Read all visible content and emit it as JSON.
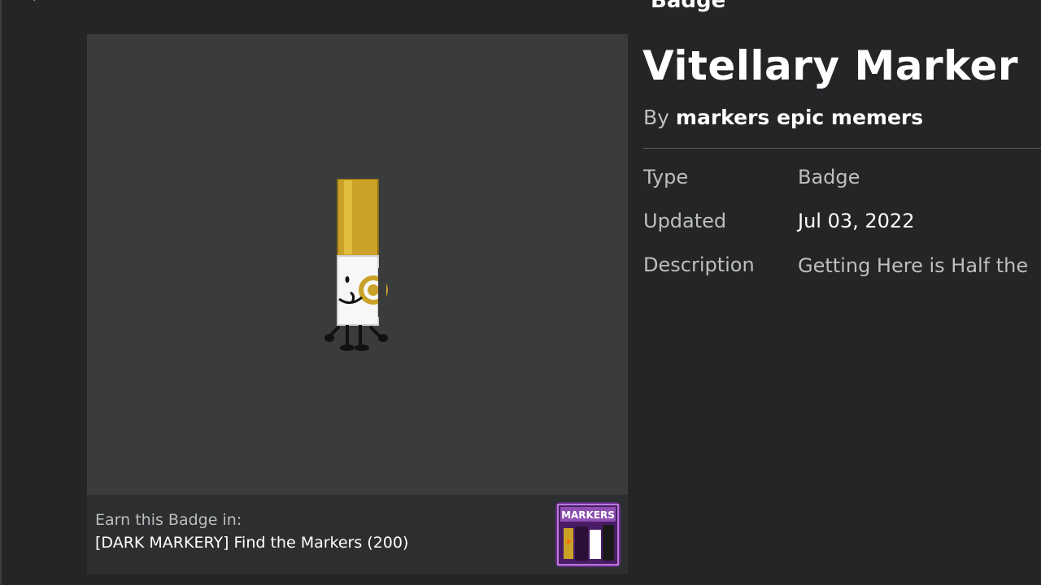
{
  "header": {
    "partial_title": "Badge"
  },
  "badge": {
    "name": "Vitellary Marker",
    "by_prefix": "By",
    "creator": "markers epic memers"
  },
  "details": {
    "type_label": "Type",
    "type_value": "Badge",
    "updated_label": "Updated",
    "updated_value": "Jul 03, 2022",
    "description_label": "Description",
    "description_value": "Getting Here is Half the"
  },
  "earn": {
    "label": "Earn this Badge in:",
    "game_name": "[DARK MARKERY] Find the Markers (200)",
    "game_icon_text": "MARKERS"
  },
  "colors": {
    "background": "#232527",
    "thumbnail_bg": "#393b3d",
    "panel_bg": "#2c2e30",
    "marker_cap": "#c9a227",
    "game_icon_purple": "#6a2a8c"
  }
}
